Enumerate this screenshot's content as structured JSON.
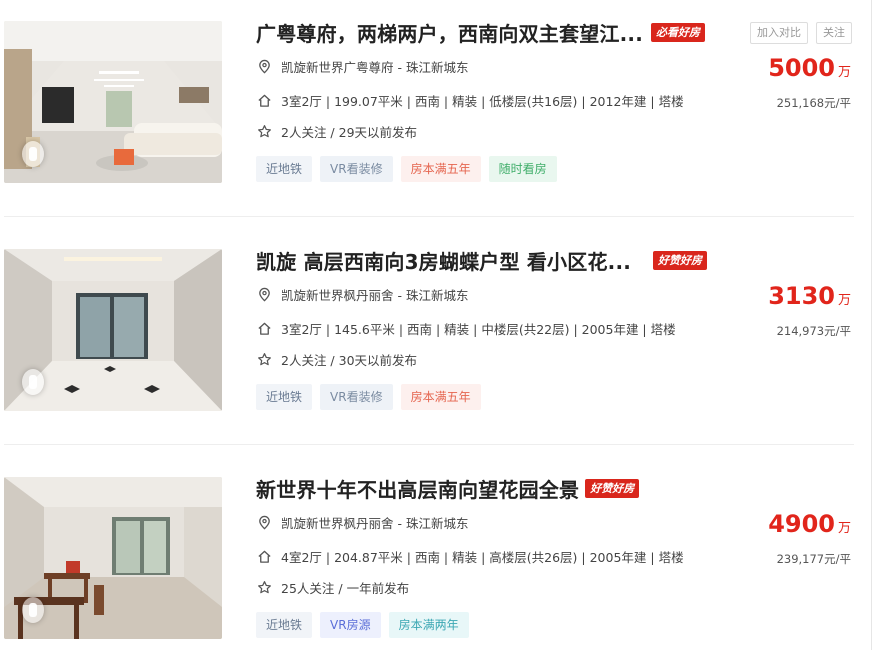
{
  "listings": [
    {
      "title": "广粤尊府，两梯两户，西南向双主套望江...",
      "badge": "必看好房",
      "community": "凯旋新世界广粤尊府 - 珠江新城东",
      "house_info": "3室2厅 | 199.07平米 | 西南 | 精装 | 低楼层(共16层) | 2012年建 | 塔楼",
      "follow_info": "2人关注 / 29天以前发布",
      "tags": [
        "近地铁",
        "VR看装修",
        "房本满五年",
        "随时看房"
      ],
      "price": "5000",
      "price_unit": "万",
      "unit_price": "251,168元/平",
      "compare_label": "加入对比",
      "follow_label": "关注"
    },
    {
      "title": "凯旋 高层西南向3房蝴蝶户型 看小区花...",
      "badge": "好赞好房",
      "community": "凯旋新世界枫丹丽舍 - 珠江新城东",
      "house_info": "3室2厅 | 145.6平米 | 西南 | 精装 | 中楼层(共22层) | 2005年建 | 塔楼",
      "follow_info": "2人关注 / 30天以前发布",
      "tags": [
        "近地铁",
        "VR看装修",
        "房本满五年"
      ],
      "price": "3130",
      "price_unit": "万",
      "unit_price": "214,973元/平"
    },
    {
      "title": "新世界十年不出高层南向望花园全景",
      "badge": "好赞好房",
      "community": "凯旋新世界枫丹丽舍 - 珠江新城东",
      "house_info": "4室2厅 | 204.87平米 | 西南 | 精装 | 高楼层(共26层) | 2005年建 | 塔楼",
      "follow_info": "25人关注 / 一年前发布",
      "tags": [
        "近地铁",
        "VR房源",
        "房本满两年"
      ],
      "price": "4900",
      "price_unit": "万",
      "unit_price": "239,177元/平"
    }
  ],
  "icons": {
    "community": "location-pin-icon",
    "house_info": "house-icon",
    "follow_info": "star-icon"
  },
  "colors": {
    "price_red": "#e1251b",
    "badge_red": "#d9261c"
  }
}
